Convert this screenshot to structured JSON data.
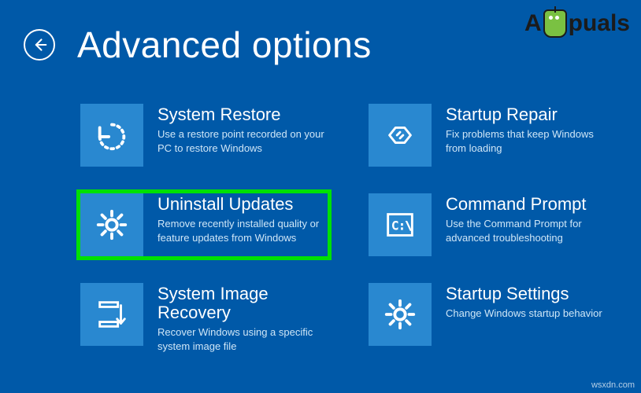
{
  "colors": {
    "background": "#0059a8",
    "tile_bg": "#2988d0",
    "highlight": "#00e000",
    "text_primary": "#ffffff",
    "text_secondary": "#cfe6f7"
  },
  "watermark": {
    "prefix": "A",
    "suffix": "puals"
  },
  "attribution": "wsxdn.com",
  "header": {
    "title": "Advanced options",
    "back_icon": "arrow-left"
  },
  "options": [
    {
      "id": "system-restore",
      "icon": "restore",
      "title": "System Restore",
      "desc": "Use a restore point recorded on your PC to restore Windows",
      "highlighted": false
    },
    {
      "id": "startup-repair",
      "icon": "wrench-tag",
      "title": "Startup Repair",
      "desc": "Fix problems that keep Windows from loading",
      "highlighted": false
    },
    {
      "id": "uninstall-updates",
      "icon": "gear",
      "title": "Uninstall Updates",
      "desc": "Remove recently installed quality or feature updates from Windows",
      "highlighted": true
    },
    {
      "id": "command-prompt",
      "icon": "cmd",
      "title": "Command Prompt",
      "desc": "Use the Command Prompt for advanced troubleshooting",
      "highlighted": false
    },
    {
      "id": "system-image-recovery",
      "icon": "image-recovery",
      "title": "System Image Recovery",
      "desc": "Recover Windows using a specific system image file",
      "highlighted": false
    },
    {
      "id": "startup-settings",
      "icon": "gear",
      "title": "Startup Settings",
      "desc": "Change Windows startup behavior",
      "highlighted": false
    }
  ]
}
